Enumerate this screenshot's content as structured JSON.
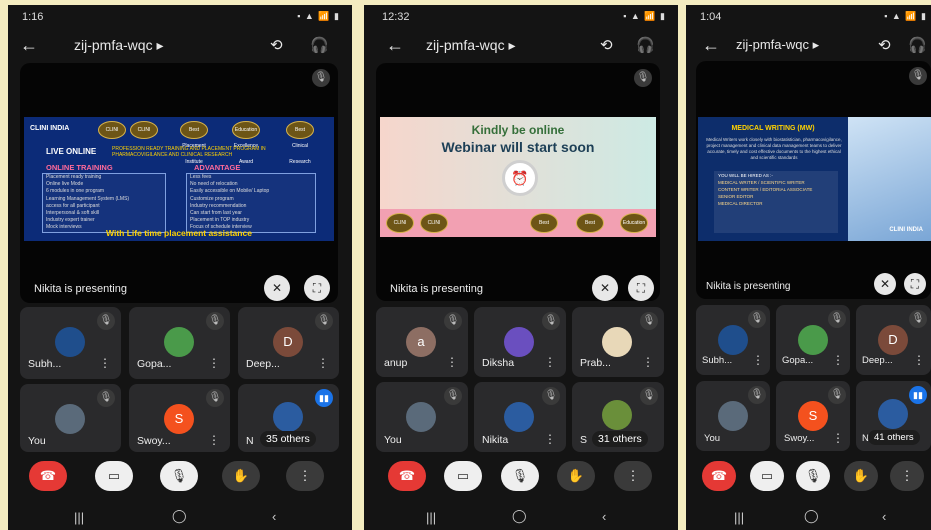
{
  "phones": [
    {
      "time": "1:16",
      "status_icons": "▪ ▲ 📶 ▮",
      "meeting_code": "zij-pmfa-wqc",
      "presenting": "Nikita is presenting",
      "tiles": [
        {
          "name": "Subh...",
          "avatar_color": "#1f4e8c",
          "avatar_text": "",
          "muted": true
        },
        {
          "name": "Gopa...",
          "avatar_color": "#4a9a4a",
          "avatar_text": "",
          "muted": true
        },
        {
          "name": "Deep...",
          "avatar_color": "#7b4a3a",
          "avatar_text": "D",
          "muted": true
        },
        {
          "name": "You",
          "avatar_color": "#5a6a7a",
          "avatar_text": "",
          "muted": true
        },
        {
          "name": "Swoy...",
          "avatar_color": "#f4511e",
          "avatar_text": "S",
          "muted": true
        },
        {
          "name": "N",
          "avatar_color": "#2b5ca0",
          "avatar_text": "",
          "muted": false
        }
      ],
      "others": "35 others",
      "slide": {
        "brand": "CLINI INDIA",
        "badges": [
          "CLINI",
          "CLINI",
          "Best Placement Institute",
          "Education Excellence Award",
          "Best Clinical Research"
        ],
        "live": "LIVE ONLINE",
        "headline": "PROFESSION READY TRAINING AND PLACEMENT PROGRAM IN PHARMACOVIGILANCE AND CLINICAL RESEARCH",
        "online_training": "ONLINE TRAINING",
        "advantage": "ADVANTAGE",
        "training_items": [
          "Placement ready training",
          "Online live Mode",
          "6 modules in one program",
          "Learning Management System (LMS)",
          "access for all participant",
          "Interpersonal & soft skill",
          "Industry expert trainer",
          "Mock interviews"
        ],
        "advantage_items": [
          "Less fees",
          "No need of relocation",
          "Easily accessible on Mobile/ Laptop",
          "Customize program",
          "Industry recommendation",
          "Can start from last year",
          "Placement in TOP industry",
          "Focus of schedule interview"
        ],
        "footer": "With Life time placement assistance"
      }
    },
    {
      "time": "12:32",
      "status_icons": "▪ ▲ 📶 ▮",
      "meeting_code": "zij-pmfa-wqc",
      "presenting": "Nikita is presenting",
      "tiles": [
        {
          "name": "anup",
          "avatar_color": "#8d6e63",
          "avatar_text": "a",
          "muted": true
        },
        {
          "name": "Diksha",
          "avatar_color": "#6a4fbf",
          "avatar_text": "",
          "muted": true
        },
        {
          "name": "Prab...",
          "avatar_color": "#e8d8b8",
          "avatar_text": "",
          "muted": true
        },
        {
          "name": "You",
          "avatar_color": "#5a6a7a",
          "avatar_text": "",
          "muted": true
        },
        {
          "name": "Nikita",
          "avatar_color": "#2b5ca0",
          "avatar_text": "",
          "muted": true
        },
        {
          "name": "S",
          "avatar_color": "#6a8f3a",
          "avatar_text": "",
          "muted": true
        }
      ],
      "others": "31 others",
      "slide": {
        "line1": "Kindly be online",
        "line2": "Webinar will start soon",
        "badges": [
          "CLINI",
          "CLINI",
          "Best Clinical Research",
          "Best Placement Institute",
          "Education Excellence Award"
        ]
      }
    },
    {
      "time": "1:04",
      "status_icons": "▪ ▲ 📶 ▮",
      "meeting_code": "zij-pmfa-wqc",
      "presenting": "Nikita is presenting",
      "tiles": [
        {
          "name": "Subh...",
          "avatar_color": "#1f4e8c",
          "avatar_text": "",
          "muted": true
        },
        {
          "name": "Gopa...",
          "avatar_color": "#4a9a4a",
          "avatar_text": "",
          "muted": true
        },
        {
          "name": "Deep...",
          "avatar_color": "#7b4a3a",
          "avatar_text": "D",
          "muted": true
        },
        {
          "name": "You",
          "avatar_color": "#5a6a7a",
          "avatar_text": "",
          "muted": true
        },
        {
          "name": "Swoy...",
          "avatar_color": "#f4511e",
          "avatar_text": "S",
          "muted": true
        },
        {
          "name": "N",
          "avatar_color": "#2b5ca0",
          "avatar_text": "",
          "muted": false
        }
      ],
      "others": "41 others",
      "slide": {
        "title": "MEDICAL WRITING (MW)",
        "text": "Medical Writers work closely with biostatistician, pharmacovigilance, project management and clinical data management teams to deliver accurate, timely and cost effective documents to the highest ethical and scientific standards",
        "hired_title": "YOU WILL BE HIRED AS :-",
        "roles": [
          "MEDICAL WRITER / SCIENTIFIC WRITER",
          "CONTENT WRITER / EDITORIAL ASSOCIATE",
          "SENIOR EDITOR",
          "MEDICAL DIRECTOR"
        ],
        "brand": "CLINI INDIA"
      }
    }
  ]
}
